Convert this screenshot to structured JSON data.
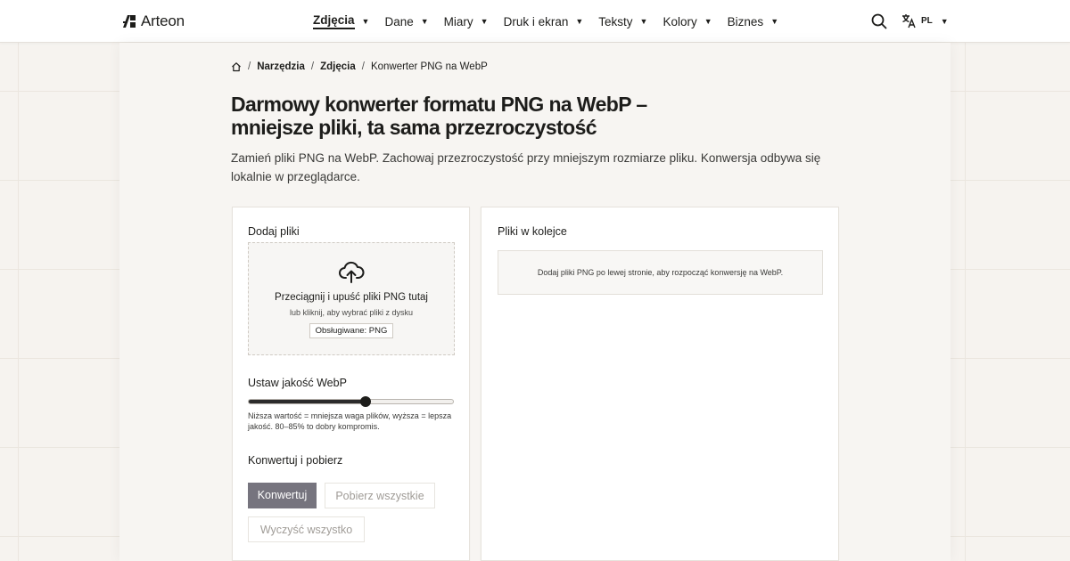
{
  "brand": {
    "name": "Arteon"
  },
  "nav": {
    "items": [
      {
        "label": "Zdjęcia",
        "active": true
      },
      {
        "label": "Dane",
        "active": false
      },
      {
        "label": "Miary",
        "active": false
      },
      {
        "label": "Druk i ekran",
        "active": false
      },
      {
        "label": "Teksty",
        "active": false
      },
      {
        "label": "Kolory",
        "active": false
      },
      {
        "label": "Biznes",
        "active": false
      }
    ],
    "caret": "▼",
    "language": "PL"
  },
  "breadcrumb": {
    "items": [
      "Narzędzia",
      "Zdjęcia",
      "Konwerter PNG na WebP"
    ],
    "separator": "/"
  },
  "page": {
    "title": "Darmowy konwerter formatu PNG na WebP – mniejsze pliki, ta sama przezroczystość",
    "subtitle": "Zamień pliki PNG na WebP. Zachowaj przezroczystość przy mniejszym rozmiarze pliku. Konwersja odbywa się lokalnie w przeglądarce."
  },
  "upload": {
    "heading": "Dodaj pliki",
    "drop_main": "Przeciągnij i upuść pliki PNG tutaj",
    "drop_sub": "lub kliknij, aby wybrać pliki z dysku",
    "supported": "Obsługiwane: PNG"
  },
  "quality": {
    "heading": "Ustaw jakość WebP",
    "value_fraction": 0.57,
    "hint": "Niższa wartość = mniejsza waga plików, wyższa = lepsza jakość. 80–85% to dobry kompromis."
  },
  "actions": {
    "heading": "Konwertuj i pobierz",
    "convert": "Konwertuj",
    "download_all": "Pobierz wszystkie",
    "clear_all": "Wyczyść wszystko"
  },
  "queue": {
    "heading": "Pliki w kolejce",
    "empty": "Dodaj pliki PNG po lewej stronie, aby rozpocząć konwersję na WebP."
  },
  "colors": {
    "text": "#1d1d1b",
    "primary_button": "#76747e",
    "background": "#f6f3ef"
  }
}
